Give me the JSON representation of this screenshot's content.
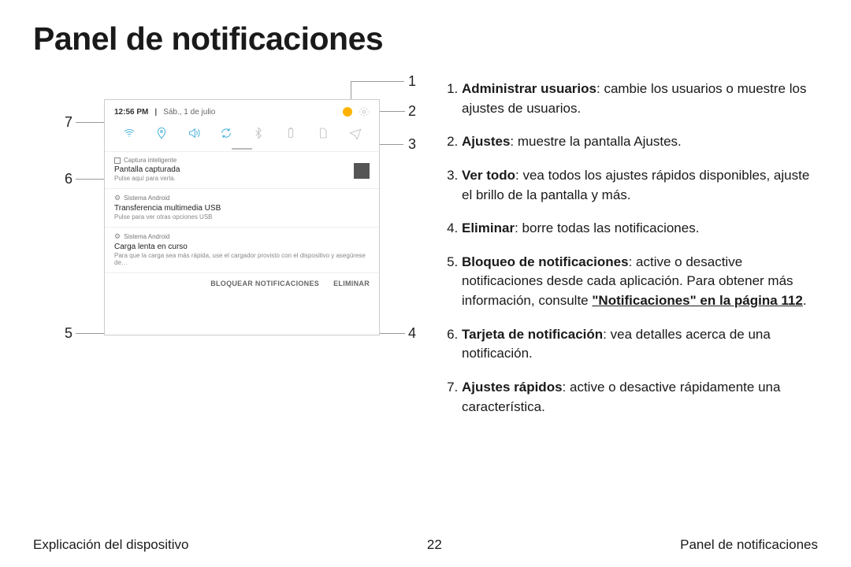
{
  "page": {
    "title": "Panel de notificaciones",
    "page_number": "22"
  },
  "footer": {
    "left": "Explicación del dispositivo",
    "right": "Panel de notificaciones"
  },
  "callouts": {
    "c1": "1",
    "c2": "2",
    "c3": "3",
    "c4": "4",
    "c5": "5",
    "c6": "6",
    "c7": "7"
  },
  "legend": {
    "n1_b": "Administrar usuarios",
    "n1_t": ": cambie los usuarios o muestre los ajustes de usuarios.",
    "n2_b": "Ajustes",
    "n2_t": ": muestre la pantalla Ajustes.",
    "n3_b": "Ver todo",
    "n3_t": ": vea todos los ajustes rápidos disponibles, ajuste el brillo de la pantalla y más.",
    "n4_b": "Eliminar",
    "n4_t": ": borre todas las notificaciones.",
    "n5_b": "Bloqueo de notificaciones",
    "n5_t1": ": active o desactive notificaciones desde cada aplicación. Para obtener más información, consulte ",
    "n5_link": "\"Notificaciones\" en la página 112",
    "n5_t2": ".",
    "n6_b": "Tarjeta de notificación",
    "n6_t": ": vea detalles acerca de una notificación.",
    "n7_b": "Ajustes rápidos",
    "n7_t": ": active o desactive rápidamente una característica."
  },
  "screenshot": {
    "time": "12:56 PM",
    "date_sep": "|",
    "date": "Sáb., 1 de julio",
    "qs_icons": [
      "wifi",
      "location",
      "sound",
      "rotate",
      "bluetooth",
      "power-saving",
      "sim",
      "airplane"
    ],
    "notif1": {
      "app": "Captura inteligente",
      "title": "Pantalla capturada",
      "sub": "Pulse aquí para verla."
    },
    "notif2": {
      "app": "Sistema Android",
      "title": "Transferencia multimedia USB",
      "sub": "Pulse para ver otras opciones USB"
    },
    "notif3": {
      "app": "Sistema Android",
      "title": "Carga lenta en curso",
      "sub": "Para que la carga sea más rápida, use el cargador provisto con el dispositivo y asegúrese de…"
    },
    "actions": {
      "block": "BLOQUEAR NOTIFICACIONES",
      "clear": "ELIMINAR"
    }
  }
}
